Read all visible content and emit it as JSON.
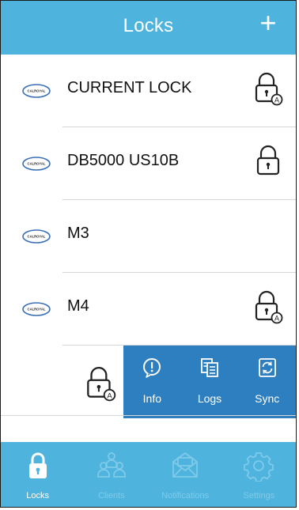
{
  "header": {
    "title": "Locks",
    "add_label": "+"
  },
  "locks": [
    {
      "name": "CURRENT LOCK",
      "lock_icon": "lock-auto-icon"
    },
    {
      "name": "DB5000 US10B",
      "lock_icon": "lock-icon"
    },
    {
      "name": "M3",
      "lock_icon": ""
    },
    {
      "name": "M4",
      "lock_icon": "lock-auto-icon"
    }
  ],
  "swipe_actions": [
    {
      "label": "Info",
      "icon": "info-icon"
    },
    {
      "label": "Logs",
      "icon": "logs-icon"
    },
    {
      "label": "Sync",
      "icon": "sync-icon"
    }
  ],
  "tabbar": [
    {
      "label": "Locks",
      "icon": "lock-icon",
      "active": true
    },
    {
      "label": "Clients",
      "icon": "clients-icon",
      "active": false
    },
    {
      "label": "Notifications",
      "icon": "notifications-icon",
      "active": false
    },
    {
      "label": "Settings",
      "icon": "settings-icon",
      "active": false
    }
  ],
  "colors": {
    "header_bg": "#4fb4dd",
    "swipe_bg": "#2d7fbf",
    "tab_active": "#ffffff",
    "tab_inactive": "#7fcaea"
  }
}
